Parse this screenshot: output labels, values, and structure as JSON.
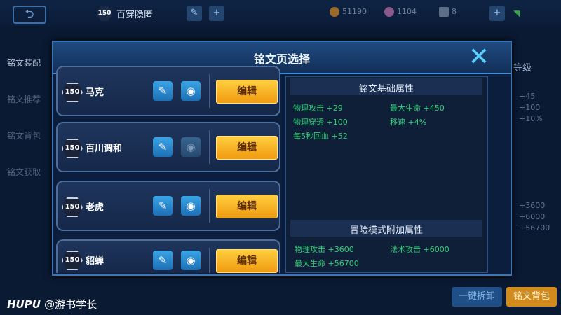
{
  "top": {
    "level": "150",
    "title": "百穿隐匿",
    "currency1": "51190",
    "currency2": "1104",
    "currency3": "8"
  },
  "left_menu": [
    "铭文装配",
    "铭文推荐",
    "铭文背包",
    "铭文获取"
  ],
  "right_bg": {
    "label": "等级",
    "values": [
      "+45",
      "+100",
      "+10%"
    ],
    "values2": [
      "+3600",
      "+6000",
      "+56700"
    ]
  },
  "bottom": {
    "btn1": "一键拆卸",
    "btn2": "铭文背包"
  },
  "dialog": {
    "title": "铭文页选择",
    "pages": [
      {
        "level": "150",
        "name": "马克",
        "edit_label": "编辑"
      },
      {
        "level": "150",
        "name": "百川调和",
        "edit_label": "编辑"
      },
      {
        "level": "150",
        "name": "老虎",
        "edit_label": "编辑"
      },
      {
        "level": "150",
        "name": "貂蝉",
        "edit_label": "编辑"
      }
    ],
    "base_section": {
      "title": "铭文基础属性",
      "attrs": [
        {
          "label": "物理攻击",
          "value": "+29"
        },
        {
          "label": "最大生命",
          "value": "+450"
        },
        {
          "label": "物理穿透",
          "value": "+100"
        },
        {
          "label": "移速",
          "value": "+4%"
        },
        {
          "label": "每5秒回血",
          "value": "+52"
        }
      ]
    },
    "adventure_section": {
      "title": "冒险模式附加属性",
      "attrs": [
        {
          "label": "物理攻击",
          "value": "+3600"
        },
        {
          "label": "法术攻击",
          "value": "+6000"
        },
        {
          "label": "最大生命",
          "value": "+56700"
        }
      ]
    }
  },
  "watermark": {
    "brand": "HUPU",
    "user": "@游书学长"
  },
  "colors": {
    "attr_green": "#2fd07a",
    "edit_orange": "#f5a623",
    "accent_blue": "#3a8fe0"
  }
}
